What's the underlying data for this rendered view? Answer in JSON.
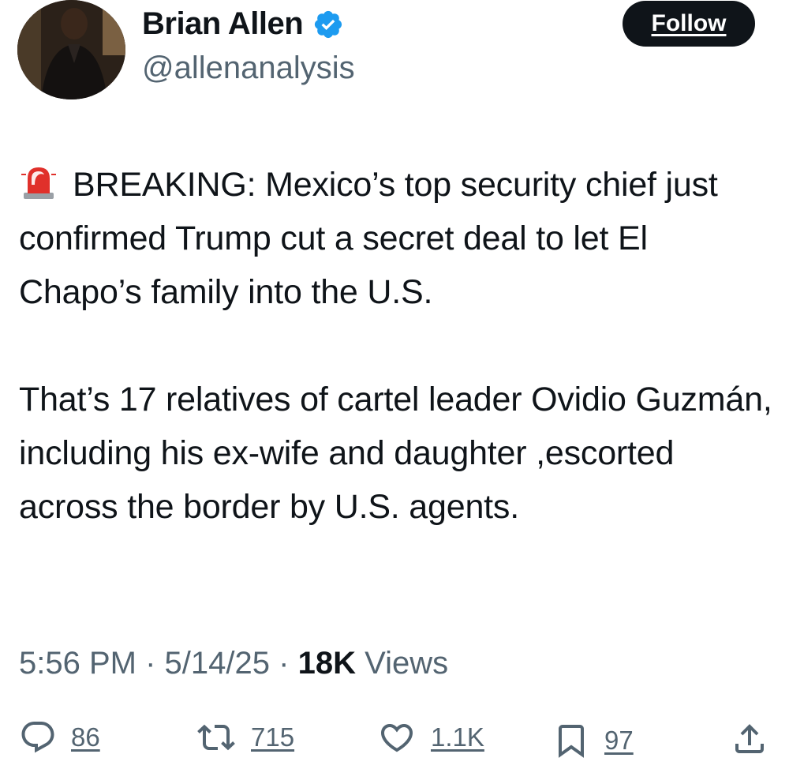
{
  "user": {
    "display_name": "Brian Allen",
    "handle": "@allenanalysis",
    "verified": true,
    "verified_color": "#1d9bf0"
  },
  "follow_button": {
    "label": "Follow"
  },
  "tweet": {
    "siren_icon": "rotating-light-emoji",
    "paragraph1": "BREAKING: Mexico’s top security chief just confirmed Trump cut a secret deal to let El Chapo’s family into the U.S.",
    "paragraph2": "That’s 17 relatives of cartel leader Ovidio Guzmán, including his ex-wife and daughter ,escorted across the border by U.S. agents."
  },
  "meta": {
    "time": "5:56 PM",
    "date": "5/14/25",
    "views_count": "18K",
    "views_label": "Views",
    "separator": "·"
  },
  "actions": {
    "replies": {
      "icon": "reply-icon",
      "count": "86"
    },
    "retweets": {
      "icon": "retweet-icon",
      "count": "715"
    },
    "likes": {
      "icon": "heart-icon",
      "count": "1.1K"
    },
    "bookmarks": {
      "icon": "bookmark-icon",
      "count": "97"
    },
    "share": {
      "icon": "share-icon"
    }
  },
  "colors": {
    "text": "#0f1419",
    "secondary": "#536471",
    "button_bg": "#0f1419"
  }
}
